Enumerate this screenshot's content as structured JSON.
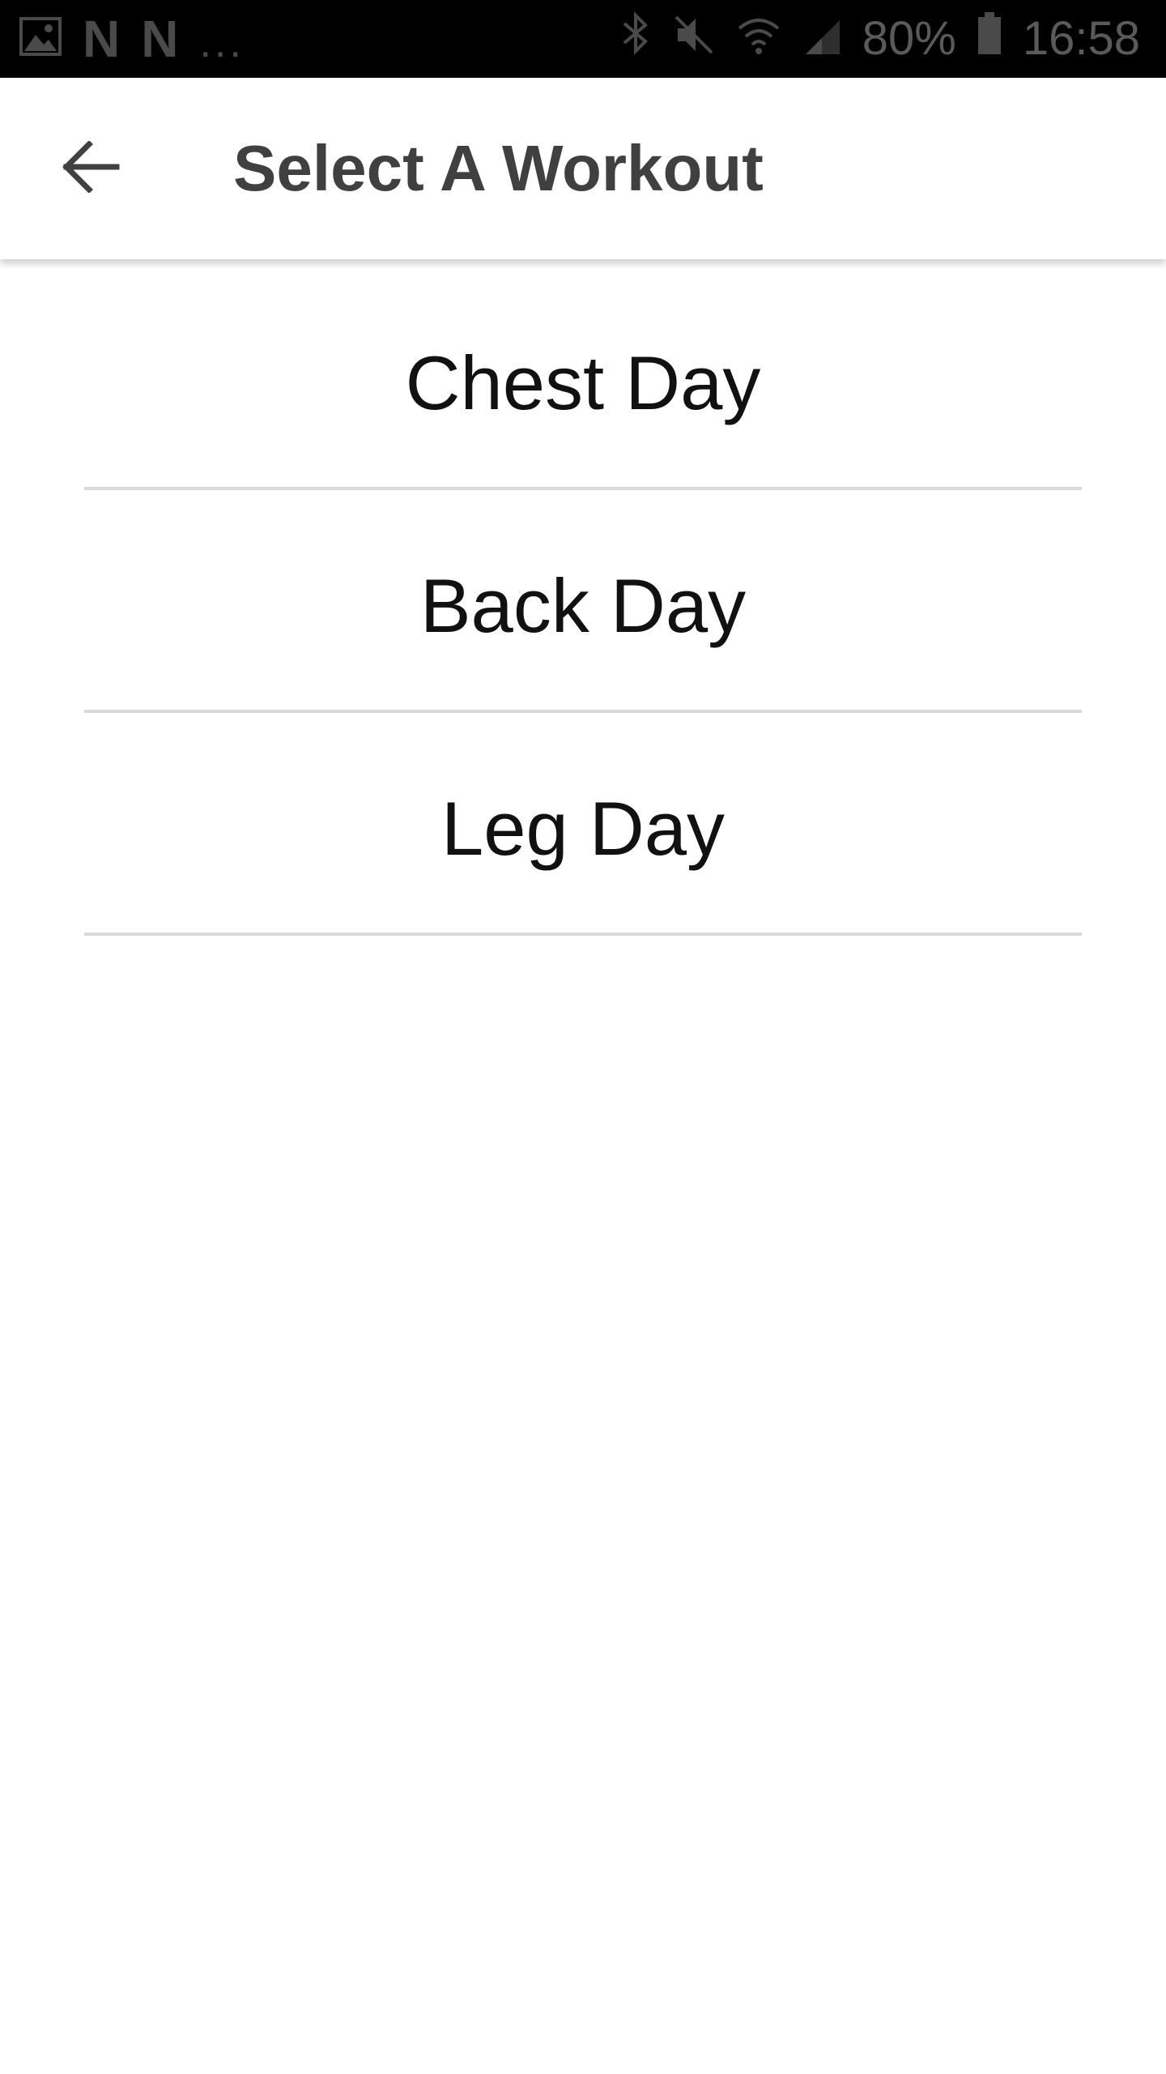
{
  "status_bar": {
    "notification_icons": [
      "gallery-icon",
      "netflix-icon",
      "netflix-icon",
      "more-icon"
    ],
    "n_glyph": "N",
    "more_text": "...",
    "system_icons": [
      "bluetooth-icon",
      "mute-icon",
      "wifi-icon",
      "signal-icon"
    ],
    "battery_percent": "80%",
    "time": "16:58"
  },
  "app_bar": {
    "back_icon": "arrow-back-icon",
    "title": "Select A Workout"
  },
  "workouts": [
    {
      "label": "Chest Day"
    },
    {
      "label": "Back Day"
    },
    {
      "label": "Leg Day"
    }
  ],
  "colors": {
    "status_bar_bg": "#000000",
    "title_text": "#404040",
    "item_text": "#111111",
    "divider": "#d9d9d9"
  }
}
